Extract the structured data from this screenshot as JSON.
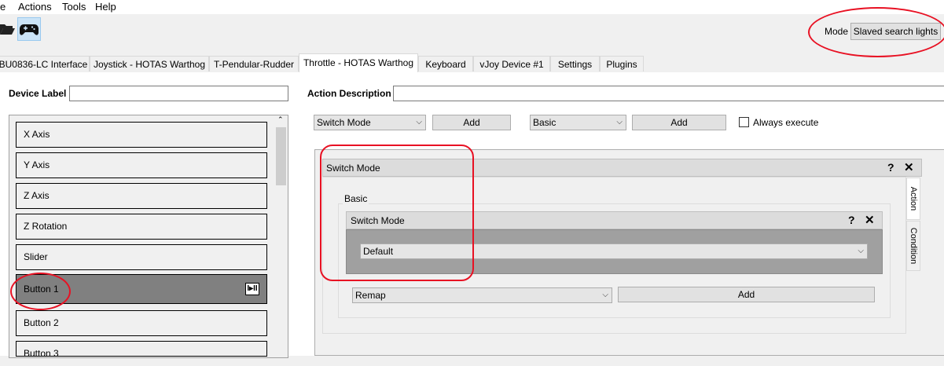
{
  "menu": [
    "e",
    "Actions",
    "Tools",
    "Help"
  ],
  "toolbar": {
    "open_icon": "folder-open-icon",
    "gamepad_icon": "gamepad-icon"
  },
  "mode": {
    "label": "Mode",
    "value": "Slaved search lights"
  },
  "tabs": [
    {
      "label": "BU0836-LC Interface"
    },
    {
      "label": "Joystick - HOTAS Warthog"
    },
    {
      "label": "T-Pendular-Rudder"
    },
    {
      "label": "Throttle - HOTAS Warthog",
      "active": true
    },
    {
      "label": "Keyboard"
    },
    {
      "label": "vJoy Device #1"
    },
    {
      "label": "Settings"
    },
    {
      "label": "Plugins"
    }
  ],
  "left": {
    "device_label": "Device Label",
    "device_label_value": "",
    "items": [
      "X Axis",
      "Y Axis",
      "Z Axis",
      "Z Rotation",
      "Slider",
      "Button 1",
      "Button 2",
      "Button 3"
    ],
    "selected_icon_text": "I▸II"
  },
  "right": {
    "action_description": "Action Description",
    "action_description_value": "",
    "container_select": "Switch Mode",
    "add_container": "Add",
    "action_select": "Basic",
    "add_action": "Add",
    "always_execute": "Always execute",
    "outer_widget_title": "Switch Mode",
    "help": "?",
    "close": "✕",
    "group_title": "Basic",
    "inner_widget_title": "Switch Mode",
    "mode_select_value": "Default",
    "remap_select": "Remap",
    "remap_add": "Add",
    "vtab_action": "Action",
    "vtab_condition": "Condition"
  },
  "colors": {
    "annotation": "#e81123",
    "selected_item": "#808080"
  }
}
